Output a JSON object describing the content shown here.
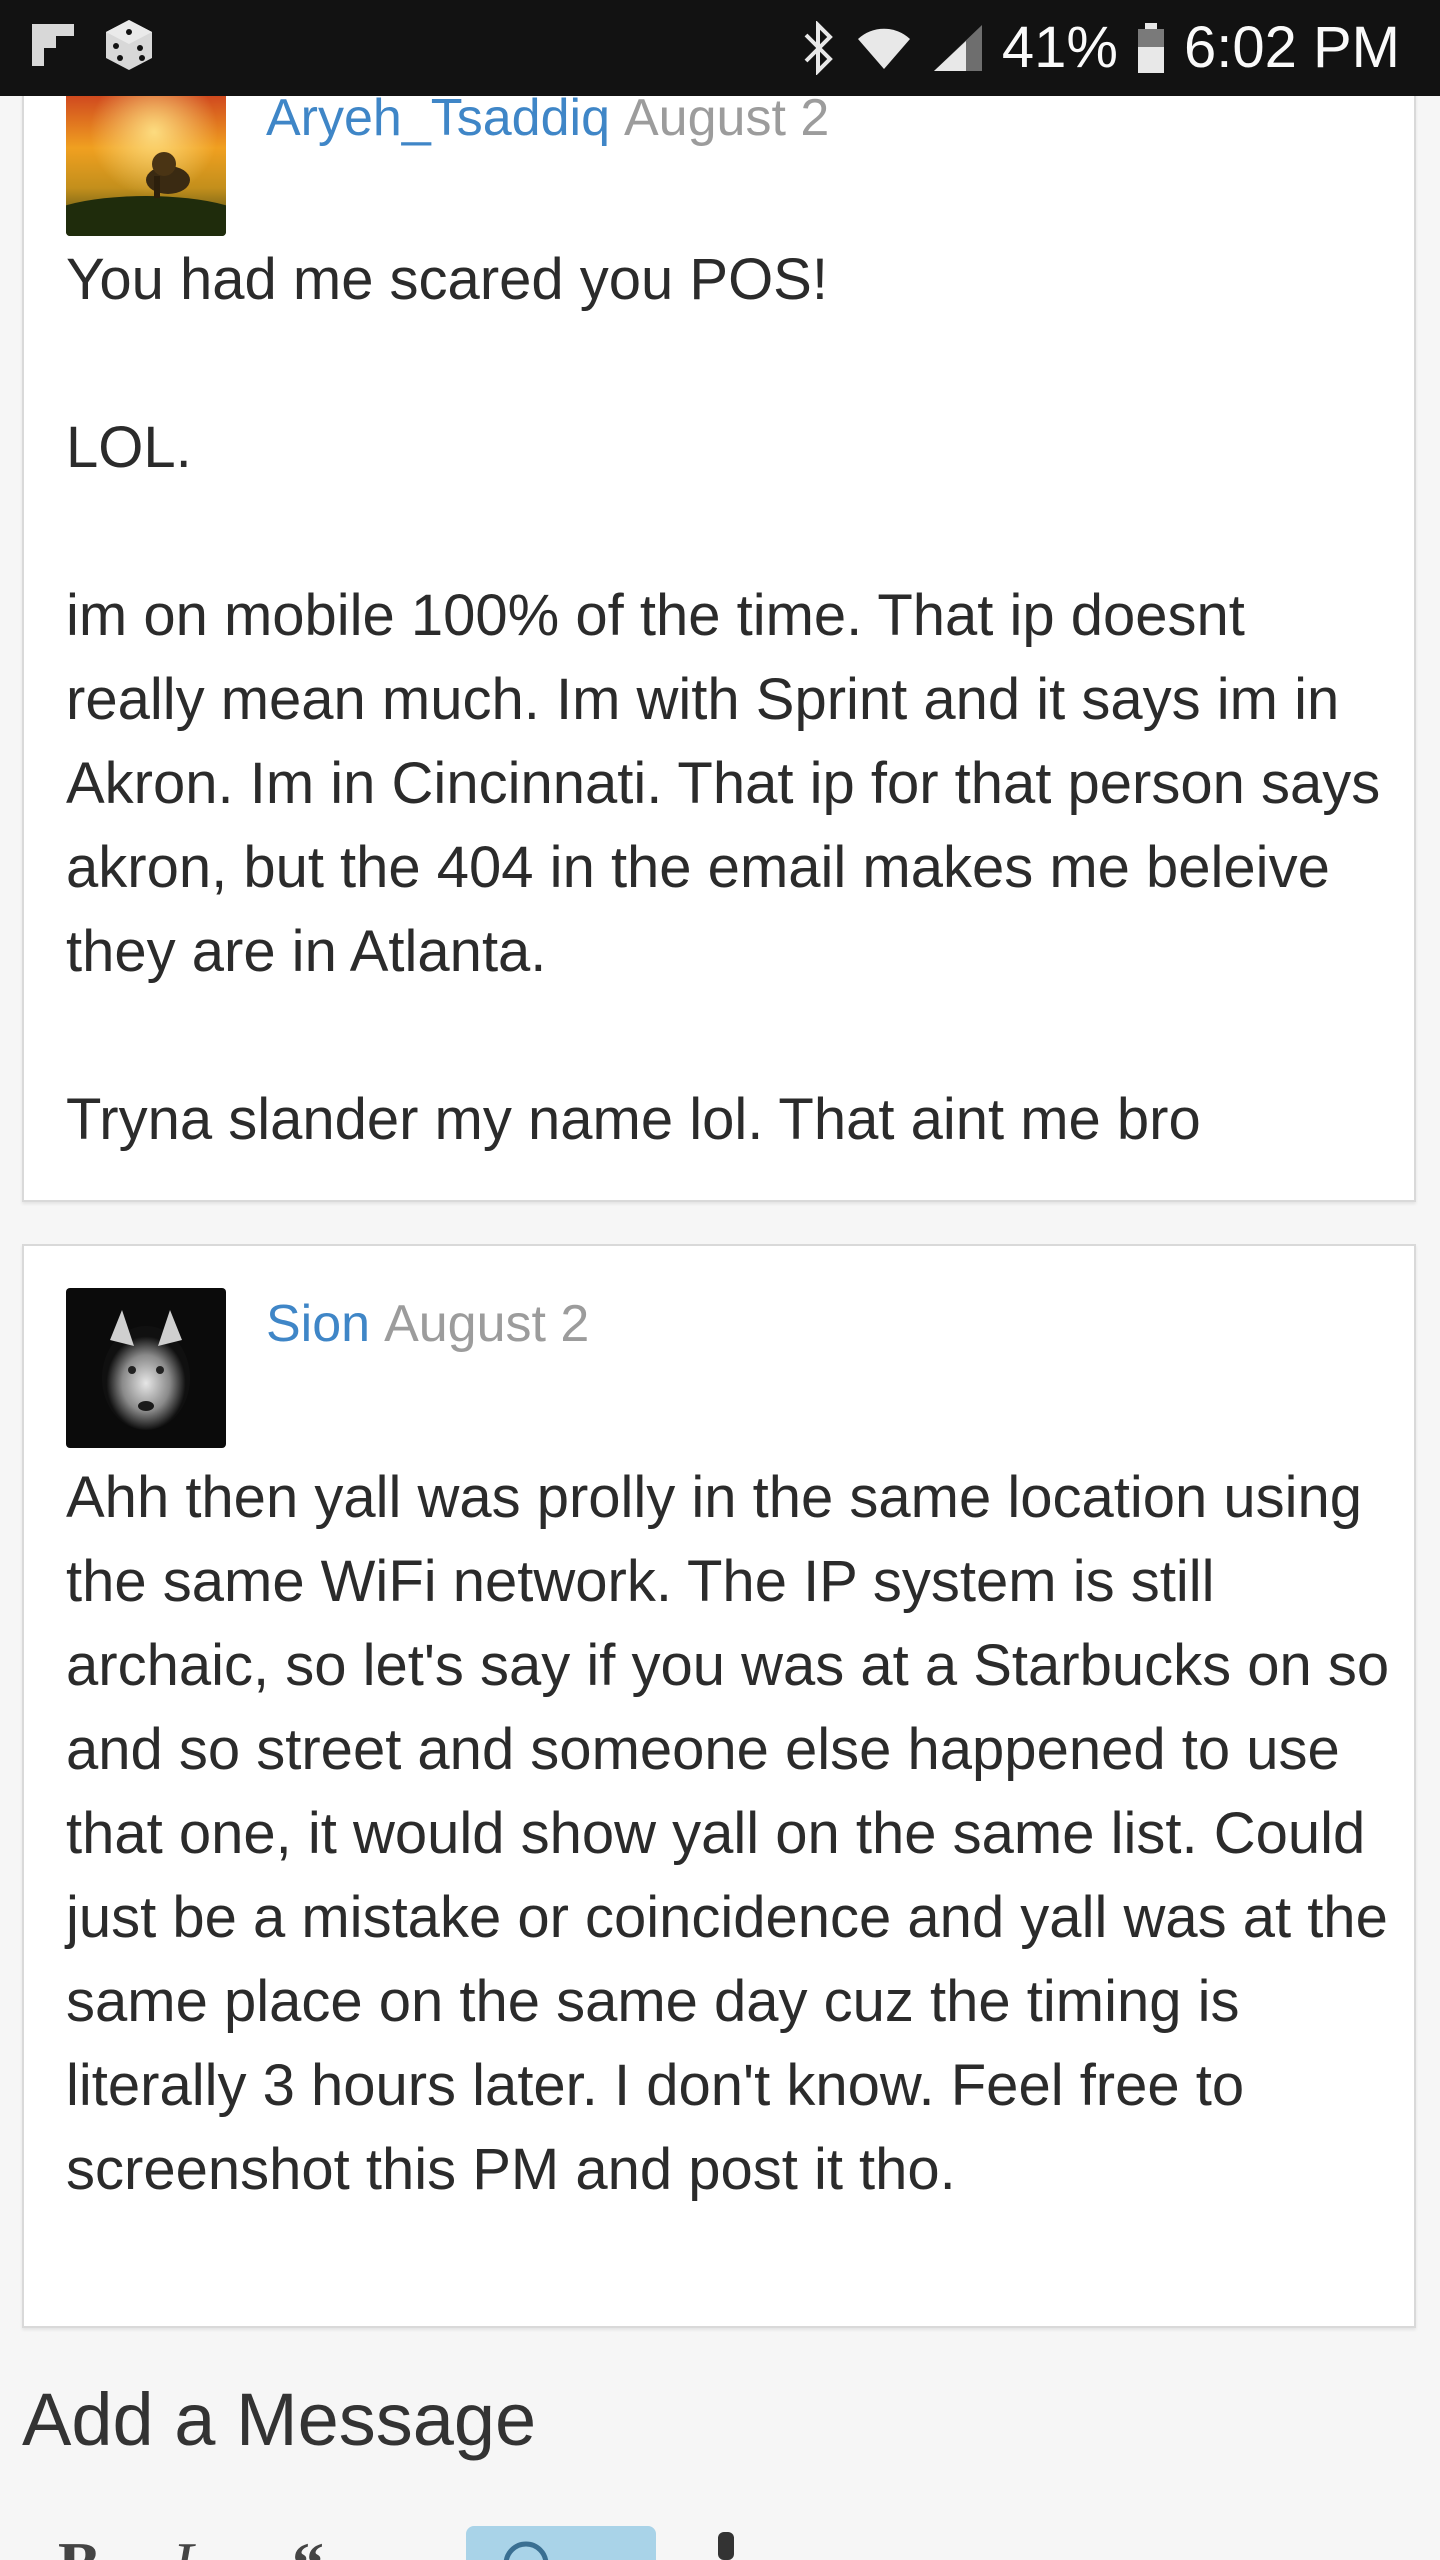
{
  "status_bar": {
    "battery": "41%",
    "time": "6:02 PM"
  },
  "posts": [
    {
      "username": "Aryeh_Tsaddiq",
      "date": "August 2",
      "paragraphs": [
        "You had me scared you POS!",
        "LOL.",
        "im on mobile 100% of the time. That ip doesnt really mean much. Im with Sprint and it says im in Akron. Im in Cincinnati. That ip for that person says akron, but the 404 in the email makes me beleive they are in Atlanta.",
        "Tryna slander my name lol. That aint me bro"
      ]
    },
    {
      "username": "Sion",
      "date": "August 2",
      "paragraphs": [
        "Ahh then yall was prolly in the same location using the same WiFi network. The IP system is still archaic, so let's say if you was at a Starbucks on so and so street and someone else happened to use that one, it would show yall on the same list. Could just be a mistake or coincidence and yall was at the same place on the same day cuz the timing is literally 3 hours later. I don't know. Feel free to screenshot this PM and post it tho."
      ]
    }
  ],
  "compose": {
    "heading": "Add a Message",
    "toolbar": {
      "bold_label": "B",
      "italic_label": "I",
      "quote_label": "“"
    }
  },
  "colors": {
    "username": "#3f86c7",
    "date": "#9c9c9c",
    "mention_button": "#a9d3e8"
  }
}
